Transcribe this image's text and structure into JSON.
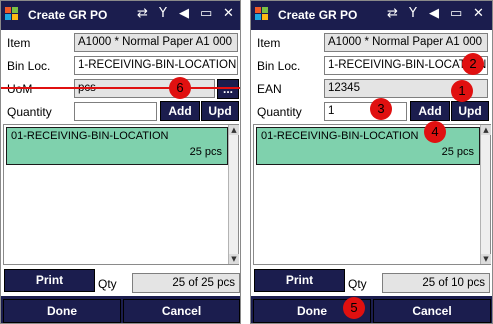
{
  "app": {
    "title": "Create GR PO",
    "status_icons": [
      "sync-icon",
      "no-signal-icon",
      "speaker-muted-icon",
      "battery-icon",
      "close-icon"
    ],
    "status_glyphs": [
      "⇄",
      "Y",
      "◀",
      "▭",
      "✕"
    ]
  },
  "left": {
    "labels": {
      "item": "Item",
      "bin": "Bin Loc.",
      "uom": "UoM",
      "quantity": "Quantity",
      "qty": "Qty"
    },
    "item_value": "A1000 * Normal Paper A1 000",
    "bin_value": "1-RECEIVING-BIN-LOCATION",
    "uom_value": "pcs",
    "uom_button": "...",
    "quantity_value": "",
    "add_label": "Add",
    "upd_label": "Upd",
    "list": [
      {
        "name": "01-RECEIVING-BIN-LOCATION",
        "qty": "25 pcs"
      }
    ],
    "print_label": "Print",
    "qty_summary": "25 of 25 pcs",
    "done_label": "Done",
    "cancel_label": "Cancel",
    "markers": {
      "m6": "6"
    }
  },
  "right": {
    "labels": {
      "item": "Item",
      "bin": "Bin Loc.",
      "ean": "EAN",
      "quantity": "Quantity",
      "qty": "Qty"
    },
    "item_value": "A1000 * Normal Paper A1 000",
    "bin_value": "1-RECEIVING-BIN-LOCATION",
    "ean_value": "12345",
    "quantity_value": "1",
    "add_label": "Add",
    "upd_label": "Upd",
    "list": [
      {
        "name": "01-RECEIVING-BIN-LOCATION",
        "qty": "25 pcs"
      }
    ],
    "print_label": "Print",
    "qty_summary": "25 of 10 pcs",
    "done_label": "Done",
    "cancel_label": "Cancel",
    "markers": {
      "m1": "1",
      "m2": "2",
      "m3": "3",
      "m4": "4",
      "m5": "5"
    }
  },
  "colors": {
    "bar": "#1b1d4e",
    "row_highlight": "#7fd1ad",
    "marker": "#e01010"
  }
}
